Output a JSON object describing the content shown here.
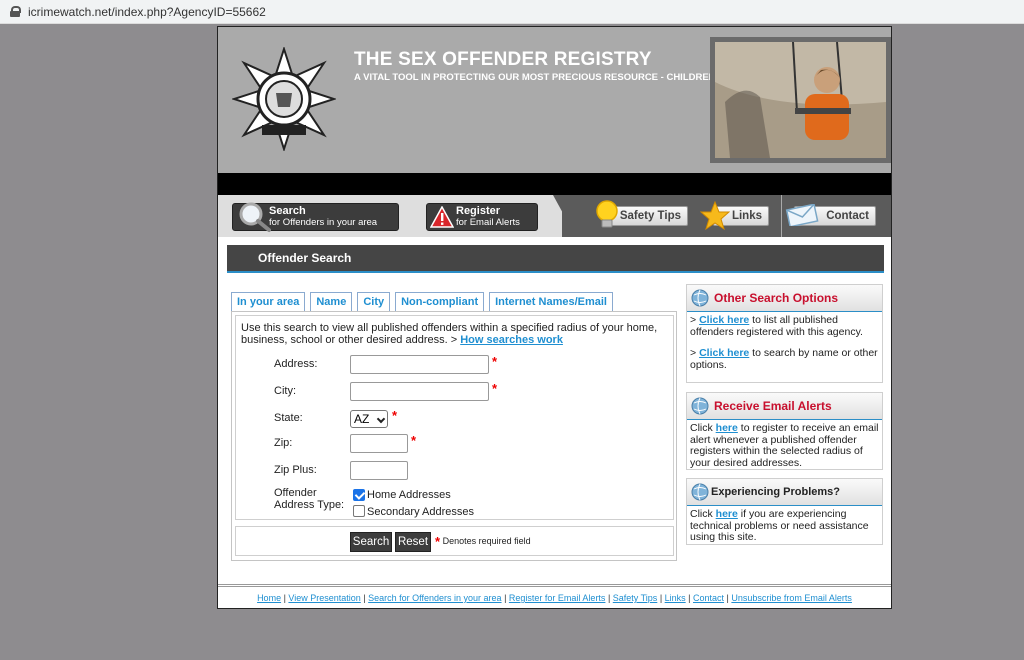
{
  "browser": {
    "url": "icrimewatch.net/index.php?AgencyID=55662"
  },
  "banner": {
    "title": "THE SEX OFFENDER REGISTRY",
    "tagline": "A VITAL TOOL IN PROTECTING OUR MOST PRECIOUS RESOURCE - CHILDREN"
  },
  "nav": {
    "search_line1": "Search",
    "search_line2": "for Offenders in your area",
    "register_line1": "Register",
    "register_line2": "for Email Alerts",
    "safety": "Safety Tips",
    "links": "Links",
    "contact": "Contact"
  },
  "section": {
    "title": "Offender Search"
  },
  "tabs": [
    "In your area",
    "Name",
    "City",
    "Non-compliant",
    "Internet Names/Email"
  ],
  "form": {
    "intro": "Use this search to view all published offenders within a specified radius of your home, business, school or other desired address. > ",
    "intro_link": "How searches work",
    "address_label": "Address:",
    "city_label": "City:",
    "state_label": "State:",
    "state_value": "AZ",
    "zip_label": "Zip:",
    "zipplus_label": "Zip Plus:",
    "type_label_1": "Offender",
    "type_label_2": "Address Type:",
    "home_label": "Home Addresses",
    "secondary_label": "Secondary Addresses",
    "search_btn": "Search",
    "reset_btn": "Reset",
    "required_note": "Denotes required field"
  },
  "sidebar": {
    "other": {
      "title": "Other Search Options",
      "p1_link": "Click here",
      "p1_text": " to list all published offenders registered with this agency.",
      "p2_link": "Click here",
      "p2_text": " to search by name or other options."
    },
    "alerts": {
      "title": "Receive Email Alerts",
      "pre": "Click ",
      "link": "here",
      "text": " to register to receive an email alert whenever a published offender registers within the selected radius of your desired addresses."
    },
    "problems": {
      "title": "Experiencing Problems?",
      "pre": "Click ",
      "link": "here",
      "text": " if you are experiencing technical problems or need assistance using this site."
    }
  },
  "footer": {
    "links": [
      "Home",
      "View Presentation",
      "Search for Offenders in your area",
      "Register for Email Alerts",
      "Safety Tips",
      "Links",
      "Contact",
      "Unsubscribe from Email Alerts"
    ]
  }
}
